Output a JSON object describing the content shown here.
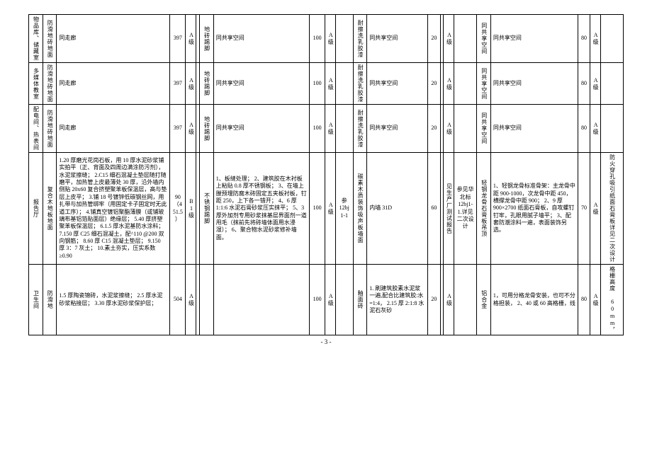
{
  "footer": "- 3 -",
  "rows": [
    {
      "room": "物品库、储藏室",
      "floor_type": "防滑地砖地面",
      "floor_desc": "同走廊",
      "floor_num": "397",
      "floor_grade": "A级",
      "skirt_type": "地砖踢脚",
      "skirt_desc": "同共享空间",
      "skirt_h": "100",
      "skirt_grade": "A级",
      "skirt_ref": "",
      "wall_type": "耐擦洗乳胶漆",
      "wall_desc": "同共享空间",
      "wall_h": "20",
      "wall_grade": "A级",
      "wall_ref": "",
      "ceil_type": "同共享空间",
      "ceil_desc": "同共享空间",
      "ceil_h": "80",
      "ceil_grade": "A级",
      "ceil_rem": ""
    },
    {
      "room": "多媒体教室",
      "floor_type": "防滑地砖地面",
      "floor_desc": "同走廊",
      "floor_num": "397",
      "floor_grade": "A级",
      "skirt_type": "地砖踢脚",
      "skirt_desc": "同共享空间",
      "skirt_h": "100",
      "skirt_grade": "A级",
      "skirt_ref": "",
      "wall_type": "耐擦洗乳胶漆",
      "wall_desc": "同共享空间",
      "wall_h": "20",
      "wall_grade": "A级",
      "wall_ref": "",
      "ceil_type": "同共享空间",
      "ceil_desc": "同共享空间",
      "ceil_h": "80",
      "ceil_grade": "A级",
      "ceil_rem": ""
    },
    {
      "room": "配电间、热表间",
      "floor_type": "防滑地砖地面",
      "floor_desc": "同走廊",
      "floor_num": "397",
      "floor_grade": "A级",
      "skirt_type": "地砖踢脚",
      "skirt_desc": "同共享空间",
      "skirt_h": "100",
      "skirt_grade": "A级",
      "skirt_ref": "",
      "wall_type": "耐擦洗乳胶漆",
      "wall_desc": "同共享空间",
      "wall_h": "20",
      "wall_grade": "A级",
      "wall_ref": "",
      "ceil_type": "同共享空间",
      "ceil_desc": "同共享空间",
      "ceil_h": "80",
      "ceil_grade": "A级",
      "ceil_rem": ""
    },
    {
      "room": "报告厅",
      "floor_type": "复合木地板地面",
      "floor_desc": "1.20 厚磨光花岗石板，用 10 厚水泥砂浆铺实拍平（正、背面及四周边满涂防污剂），水泥浆擦缝；\n2.C15 细石混凝土垫层随打随磨平，加热管上皮最薄处 30 厚，沿外墙内侧贴 20x60 复合挤塑聚苯板保温层，高与垫层上皮平；\n3.铺 18 号镀锌低碳钢丝网，用扎带与加热管绑牢（用固定卡子固定时无此道工序）；\n4.铺真空镀铝聚酯薄膜（或铺玻璃布基铝箔贴面层）绝缘层；\n5.40 厚挤塑聚苯板保温层；\n6.1.5 厚水泥基防水涂料；\n7.150 厚 C25 细石混凝土，配^110 @200 双向钢筋；\n8.60 厚 C15 混凝土垫层；\n9.150 厚 3：7 灰土；\n10.素土夯实，压实系数≥0.90",
      "floor_num": "90（451.5）",
      "floor_grade": "B1级",
      "skirt_type": "不锈钢踢脚",
      "skirt_desc": "1、板缝处理；\n2、建筑胶在木衬板上粘贴 0.8 厚不锈钢板；\n3、在墙上膛预埋防腐木砖固定五夹板衬板，钉距 250，上下各一错开；\n4、6 厚 1:1:6 水泥石膏砂浆压实抹平；\n5、3 厚外加剂专用砂浆抹基层界面剂一道甩毛（抹前先将砖墙体面用水浸湿）；\n6、聚合物水泥砂浆修补墙面。",
      "skirt_h": "100",
      "skirt_grade": "A级",
      "skirt_ref": "参 12bj1-1",
      "wall_type": "碳素木质装饰吸声板墙面",
      "wall_desc": "内墙 31D",
      "wall_h": "60",
      "wall_grade": "见生产厂测试报告",
      "wall_ref": "参见华北标 12bj1-1.详见二次设计",
      "ceil_type": "轻钢龙骨石膏板吊顶",
      "ceil_desc": "1、轻钢龙骨标准骨架：主龙骨中距 900-1000，次龙骨中距 450，横撑龙骨中距 900；\n2、9 厚 900×2700 纸面石膏板，自攻螺钉钉牢，孔眼用腻子墙平；\n3、配套防潮涂料一遍，表面装饰另选。",
      "ceil_h": "70",
      "ceil_grade": "A级",
      "ceil_rem": "防火穿孔吸引纸面石膏板详见二次设计"
    },
    {
      "room": "卫生间",
      "floor_type": "防滑地",
      "floor_desc": "1.5 厚陶瓷锦砖，水泥浆擦缝；\n2.5 厚水泥砂浆粘接层；\n3.30 厚水泥砂浆保护层；",
      "floor_num": "504",
      "floor_grade": "A级",
      "skirt_type": "",
      "skirt_desc": "",
      "skirt_h": "100",
      "skirt_grade": "A级",
      "skirt_ref": "",
      "wall_type": "釉面砖",
      "wall_desc": "1. 刷建筑胶素水泥浆一遍,配合比建筑胶:水=1:4，\n2.15 厚 2:1:8 水泥石灰砂",
      "wall_h": "20",
      "wall_grade": "A级",
      "wall_ref": "",
      "ceil_type": "铝合金",
      "ceil_desc": "1，可用分格龙骨安装，也可不分格担装，\n2、40 或 60 高格栅，线",
      "ceil_h": "80",
      "ceil_grade": "A级",
      "ceil_rem": "格栅高度 60mm，"
    }
  ]
}
